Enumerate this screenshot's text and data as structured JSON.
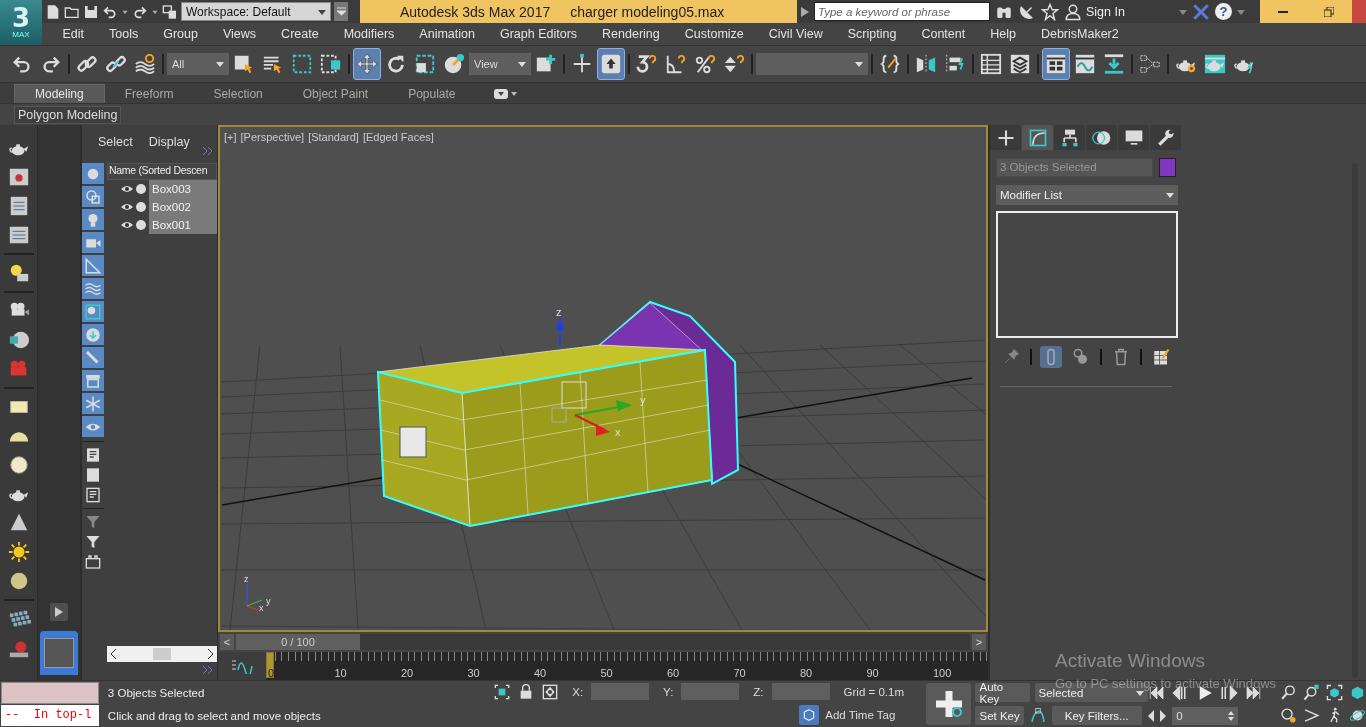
{
  "app": {
    "logo": "3",
    "logo_caption": "MAX"
  },
  "quick_access": {
    "workspace": "Workspace: Default"
  },
  "title_bar": {
    "title": "Autodesk 3ds Max 2017",
    "document": "charger modeling05.max"
  },
  "search": {
    "placeholder": "Type a keyword or phrase"
  },
  "account": {
    "sign_in": "Sign In",
    "help": "?"
  },
  "menu": [
    "Edit",
    "Tools",
    "Group",
    "Views",
    "Create",
    "Modifiers",
    "Animation",
    "Graph Editors",
    "Rendering",
    "Customize",
    "Civil View",
    "Scripting",
    "Content",
    "Help",
    "DebrisMaker2"
  ],
  "main_toolbar": {
    "selection_filter": "All",
    "reference_coordinate": "View",
    "buttons": [
      {
        "selected": false
      },
      {
        "selected": false
      },
      {
        "selected": false
      },
      {
        "selected": false
      },
      {
        "selected": false
      },
      {
        "selected": false
      },
      {
        "selected": false
      },
      {
        "selected": false
      },
      {
        "selected": false
      },
      {
        "selected": true
      },
      {
        "selected": false
      },
      {
        "selected": false
      },
      {
        "selected": false
      },
      {
        "selected": false
      },
      {
        "selected": false
      },
      {
        "selected": true
      },
      {
        "selected": false
      },
      {
        "selected": false
      },
      {
        "selected": false
      },
      {
        "selected": false
      },
      {
        "selected": false
      },
      {
        "selected": false
      },
      {
        "selected": false
      },
      {
        "selected": false
      },
      {
        "selected": false
      },
      {
        "selected": true
      },
      {
        "selected": false
      },
      {
        "selected": false
      },
      {
        "selected": false
      },
      {
        "selected": false
      },
      {
        "selected": false
      },
      {
        "selected": false
      }
    ]
  },
  "ribbon": {
    "tabs": [
      {
        "label": "Modeling",
        "selected": true
      },
      {
        "label": "Freeform",
        "selected": false
      },
      {
        "label": "Selection",
        "selected": false
      },
      {
        "label": "Object Paint",
        "selected": false
      },
      {
        "label": "Populate",
        "selected": false
      }
    ],
    "panel": "Polygon Modeling"
  },
  "scene_explorer": {
    "tabs": [
      "Select",
      "Display"
    ],
    "filters": [
      {
        "on": true
      },
      {
        "on": true
      },
      {
        "on": true
      },
      {
        "on": true
      },
      {
        "on": true
      },
      {
        "on": true
      },
      {
        "on": true
      },
      {
        "on": true
      },
      {
        "on": true
      },
      {
        "on": true
      },
      {
        "on": true
      },
      {
        "on": true
      }
    ],
    "column": "Name (Sorted Descen",
    "items": [
      {
        "name": "Box003",
        "selected": true
      },
      {
        "name": "Box002",
        "selected": true
      },
      {
        "name": "Box001",
        "selected": true
      }
    ]
  },
  "viewport": {
    "labels": [
      "[+]",
      "[Perspective]",
      "[Standard]",
      "[Edged Faces]"
    ],
    "gizmo_axes": [
      "z",
      "y",
      "x"
    ],
    "tripod_axes": [
      "z",
      "y",
      "x"
    ]
  },
  "command_panel": {
    "tabs": [
      {
        "selected": false
      },
      {
        "selected": true
      },
      {
        "selected": false
      },
      {
        "selected": false
      },
      {
        "selected": false
      },
      {
        "selected": false
      }
    ],
    "object_name": "3 Objects Selected",
    "modifier_list": "Modifier List",
    "stack_tools": [
      {
        "selected": false
      },
      {
        "selected": true
      },
      {
        "selected": false
      },
      {
        "selected": false
      },
      {
        "selected": false
      }
    ]
  },
  "time_slider": {
    "prev": "<",
    "reading": "0 / 100",
    "next": ">",
    "level": 0
  },
  "track_bar": {
    "ticks": [
      "0",
      "10",
      "20",
      "30",
      "40",
      "50",
      "60",
      "70",
      "80",
      "90",
      "100"
    ]
  },
  "listener": {
    "output": "--  In top-l"
  },
  "status": {
    "selection": "3 Objects Selected",
    "prompt": "Click and drag to select and move objects",
    "coords": [
      {
        "label": "X:"
      },
      {
        "label": "Y:"
      },
      {
        "label": "Z:"
      }
    ],
    "grid": "Grid = 0.1m",
    "time_tag": "Add Time Tag"
  },
  "animation": {
    "auto_key": "Auto Key",
    "key_mode": "Selected",
    "set_key": "Set Key",
    "key_filters": "Key Filters...",
    "frame": "0"
  },
  "activation": {
    "title": "Activate Windows",
    "message": "Go to PC settings to activate Windows"
  }
}
